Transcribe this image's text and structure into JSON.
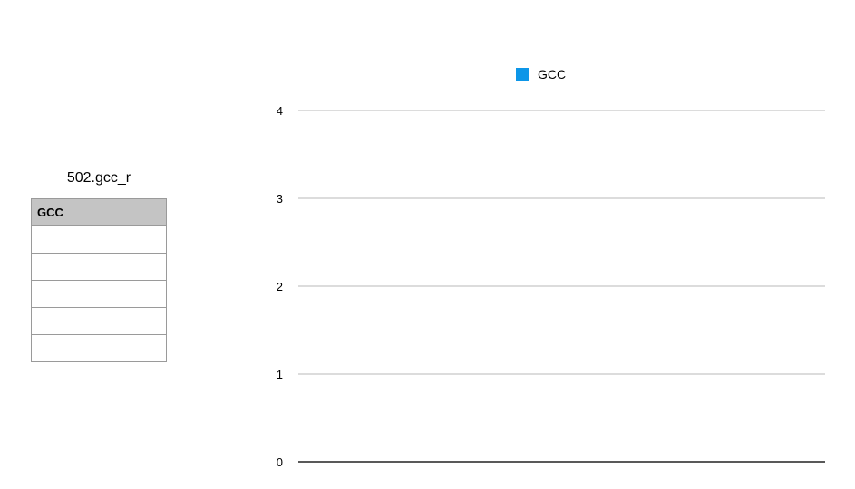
{
  "table": {
    "title": "502.gcc_r",
    "header": "GCC",
    "rows": [
      "",
      "",
      "",
      "",
      ""
    ]
  },
  "chart_data": {
    "type": "bar",
    "title": "",
    "xlabel": "",
    "ylabel": "",
    "categories": [],
    "series": [
      {
        "name": "GCC",
        "values": [],
        "color": "#0d96e8"
      }
    ],
    "yticks": [
      0,
      1,
      2,
      3,
      4
    ],
    "ylim": [
      0,
      4
    ],
    "grid": true,
    "legend_position": "top-center",
    "gridline_color": "#c6c6c6",
    "baseline_color": "#222222"
  }
}
